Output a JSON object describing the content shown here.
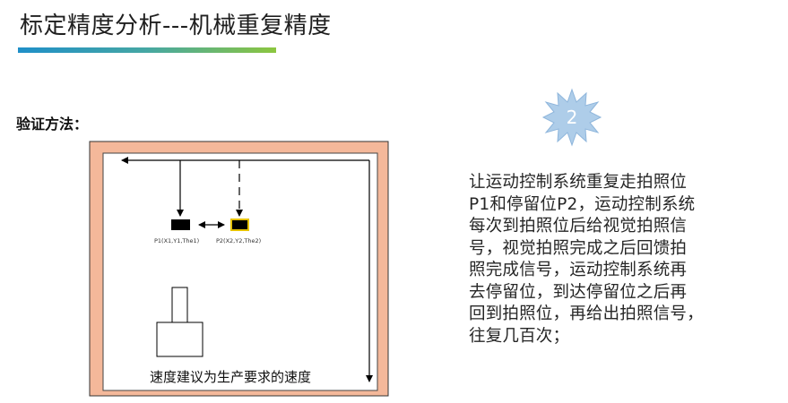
{
  "title": "标定精度分析---机械重复精度",
  "method_label": "验证方法：",
  "step_number": "2",
  "diagram": {
    "p1_label": "P1(X1,Y1,The1)",
    "p2_label": "P2(X2,Y2,The2)",
    "speed_note": "速度建议为生产要求的速度"
  },
  "description_lines": [
    "让运动控制系统重复走拍照位",
    "P1和停留位P2，运动控制系统",
    "每次到拍照位后给视觉拍照信",
    "号，视觉拍照完成之后回馈拍",
    "照完成信号，运动控制系统再",
    "去停留位，到达停留位之后再",
    "回到拍照位，再给出拍照信号，",
    "往复几百次；"
  ],
  "colors": {
    "outer_frame": "#f4b89a",
    "star_fill": "#aecde9",
    "star_stroke": "#8fb6dc",
    "p2_outline": "#e6c200"
  }
}
